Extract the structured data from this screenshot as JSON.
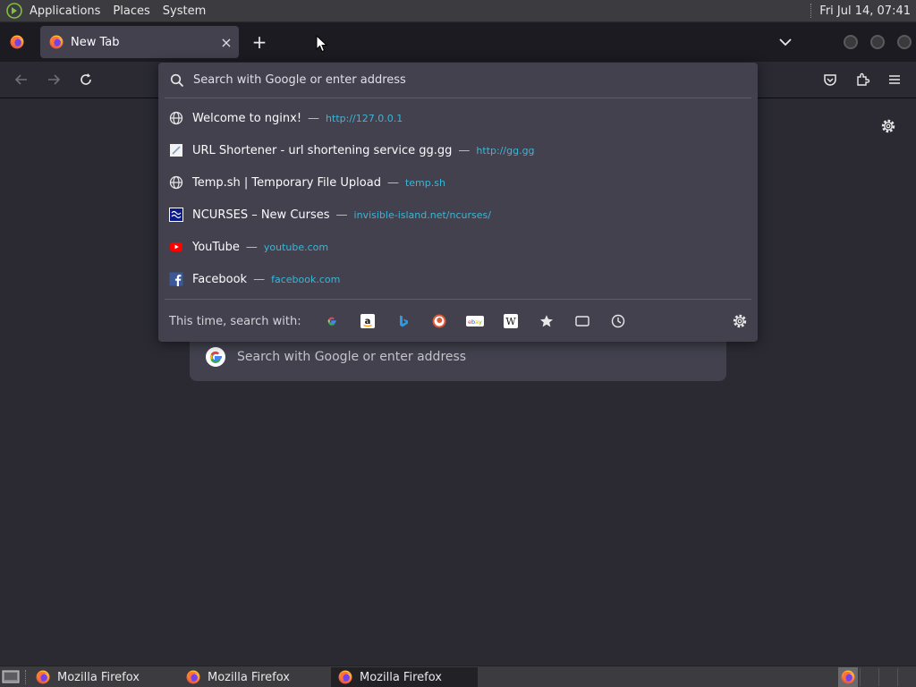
{
  "top_panel": {
    "menus": [
      "Applications",
      "Places",
      "System"
    ],
    "clock": "Fri Jul 14, 07:41"
  },
  "browser": {
    "tab": {
      "title": "New Tab",
      "close": "×"
    },
    "new_tab_symbol": "+",
    "urlbar": {
      "placeholder": "Search with Google or enter address",
      "results": [
        {
          "title": "Welcome to nginx!",
          "url": "http://127.0.0.1",
          "icon": "globe-icon"
        },
        {
          "title": "URL Shortener - url shortening service gg.gg",
          "url": "http://gg.gg",
          "icon": "ggg-favicon"
        },
        {
          "title": "Temp.sh | Temporary File Upload",
          "url": "temp.sh",
          "icon": "globe-icon"
        },
        {
          "title": "NCURSES – New Curses",
          "url": "invisible-island.net/ncurses/",
          "icon": "ncurses-favicon"
        },
        {
          "title": "YouTube",
          "url": "youtube.com",
          "icon": "youtube-icon"
        },
        {
          "title": "Facebook",
          "url": "facebook.com",
          "icon": "facebook-icon"
        }
      ],
      "dash": "—",
      "one_offs_label": "This time, search with:",
      "engines": [
        {
          "name": "google",
          "glyph": "G"
        },
        {
          "name": "amazon",
          "glyph": "a"
        },
        {
          "name": "bing",
          "glyph": "b"
        },
        {
          "name": "duckduckgo",
          "glyph": ""
        },
        {
          "name": "ebay",
          "glyph": "ebay"
        },
        {
          "name": "wikipedia",
          "glyph": "W"
        },
        {
          "name": "bookmarks",
          "glyph": "★"
        },
        {
          "name": "tabs",
          "glyph": ""
        },
        {
          "name": "history",
          "glyph": ""
        }
      ]
    },
    "page_search_placeholder": "Search with Google or enter address"
  },
  "taskbar": {
    "windows": [
      "Mozilla Firefox",
      "Mozilla Firefox",
      "Mozilla Firefox"
    ]
  },
  "colors": {
    "url_accent": "#3eb5d6",
    "popup_bg": "#42414d",
    "page_bg": "#2b2a33"
  }
}
